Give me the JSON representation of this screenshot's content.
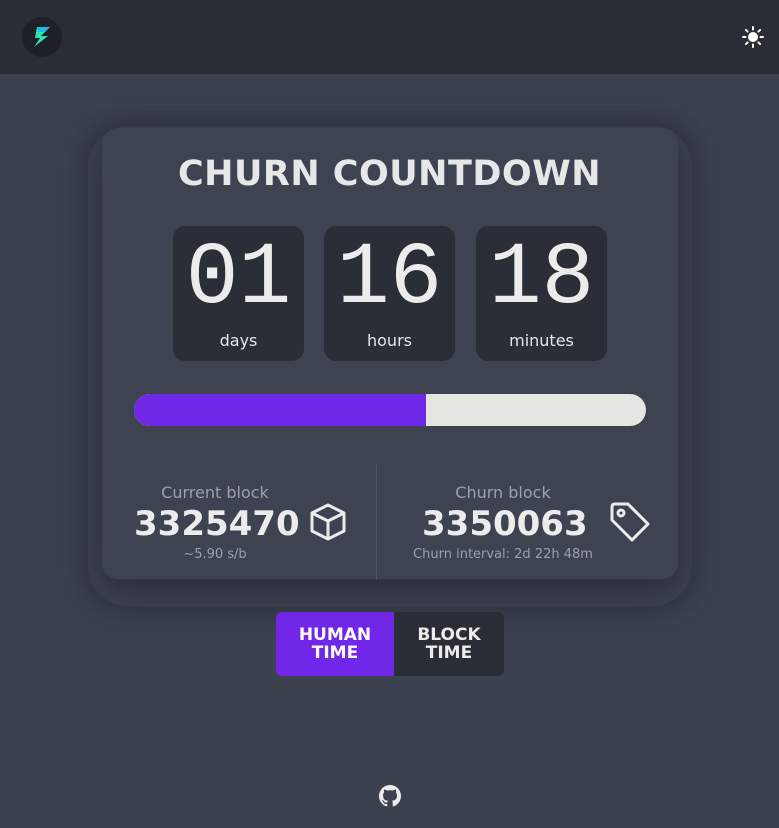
{
  "header": {
    "logo_icon": "lightning-icon",
    "theme_toggle_icon": "sun-icon"
  },
  "title": "CHURN COUNTDOWN",
  "countdown": [
    {
      "value": "01",
      "label": "days"
    },
    {
      "value": "16",
      "label": "hours"
    },
    {
      "value": "18",
      "label": "minutes"
    }
  ],
  "progress": {
    "fraction": 0.57,
    "fill_color": "#7027e7",
    "track_color": "#e6e6e2"
  },
  "current_block": {
    "label": "Current block",
    "value": "3325470",
    "sub": "~5.90 s/b",
    "icon": "cube-icon"
  },
  "churn_block": {
    "label": "Churn block",
    "value": "3350063",
    "sub": "Churn interval: 2d 22h 48m",
    "icon": "tag-icon"
  },
  "mode_toggle": {
    "human_line1": "HUMAN",
    "human_line2": "TIME",
    "block_line1": "BLOCK",
    "block_line2": "TIME",
    "active": "human"
  },
  "footer": {
    "icon": "github-icon"
  },
  "colors": {
    "accent": "#7027e7",
    "background": "#3c4150",
    "header": "#292d36",
    "logo_green": "#2de3b5"
  }
}
